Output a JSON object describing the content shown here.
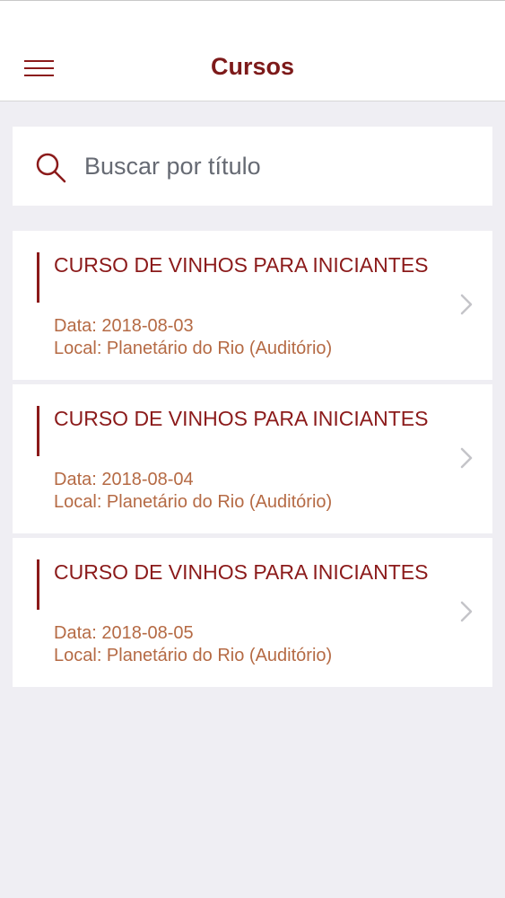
{
  "header": {
    "title": "Cursos"
  },
  "search": {
    "placeholder": "Buscar por título"
  },
  "courses": [
    {
      "title": "CURSO DE VINHOS PARA INICIANTES",
      "date": "Data: 2018-08-03",
      "location": "Local: Planetário do Rio (Auditório)"
    },
    {
      "title": "CURSO DE VINHOS PARA INICIANTES",
      "date": "Data: 2018-08-04",
      "location": "Local: Planetário do Rio (Auditório)"
    },
    {
      "title": "CURSO DE VINHOS PARA INICIANTES",
      "date": "Data: 2018-08-05",
      "location": "Local: Planetário do Rio (Auditório)"
    }
  ],
  "colors": {
    "accent": "#8b1a1a",
    "meta_text": "#b56a44",
    "background": "#efeef3"
  },
  "icons": {
    "menu": "hamburger-menu-icon",
    "search": "search-icon",
    "chevron": "chevron-right-icon"
  }
}
